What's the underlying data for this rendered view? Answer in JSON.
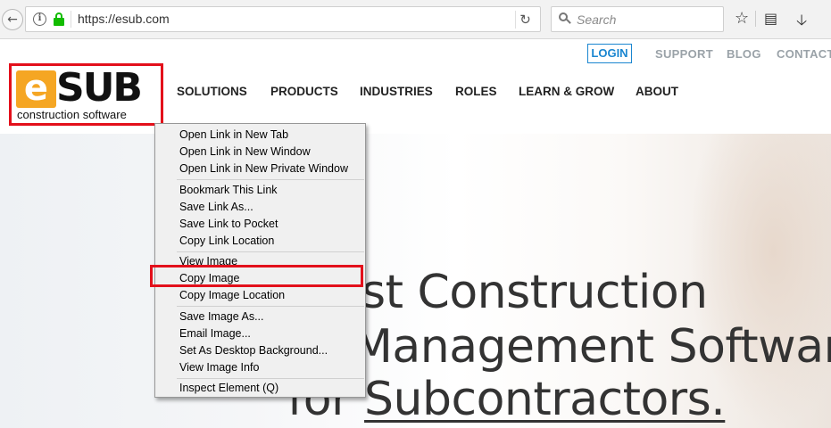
{
  "browser": {
    "url": "https://esub.com",
    "search_placeholder": "Search",
    "icons": [
      "back-arrow-icon",
      "info-icon",
      "lock-icon",
      "reload-icon",
      "search-icon",
      "star-icon",
      "reading-list-icon",
      "download-icon"
    ]
  },
  "site": {
    "top_links": {
      "login": "LOGIN",
      "support": "SUPPORT",
      "blog": "BLOG",
      "contact": "CONTACT"
    },
    "logo": {
      "letter": "e",
      "name": "SUB",
      "tagline": "construction software"
    },
    "main_nav": [
      "SOLUTIONS",
      "PRODUCTS",
      "INDUSTRIES",
      "ROLES",
      "LEARN & GROW",
      "ABOUT"
    ],
    "hero": {
      "line1": "st Construction",
      "line2": "Management Software",
      "line3_prefix": "for ",
      "line3_underlined": "Subcontractors."
    }
  },
  "context_menu": {
    "items": [
      "Open Link in New Tab",
      "Open Link in New Window",
      "Open Link in New Private Window",
      "Bookmark This Link",
      "Save Link As...",
      "Save Link to Pocket",
      "Copy Link Location",
      "View Image",
      "Copy Image",
      "Copy Image Location",
      "Save Image As...",
      "Email Image...",
      "Set As Desktop Background...",
      "View Image Info",
      "Inspect Element (Q)"
    ],
    "highlighted_item": "Copy Image"
  },
  "colors": {
    "highlight": "#e3101b",
    "login_blue": "#1a86d0",
    "logo_orange": "#f5a623",
    "lock_green": "#12bc00"
  }
}
